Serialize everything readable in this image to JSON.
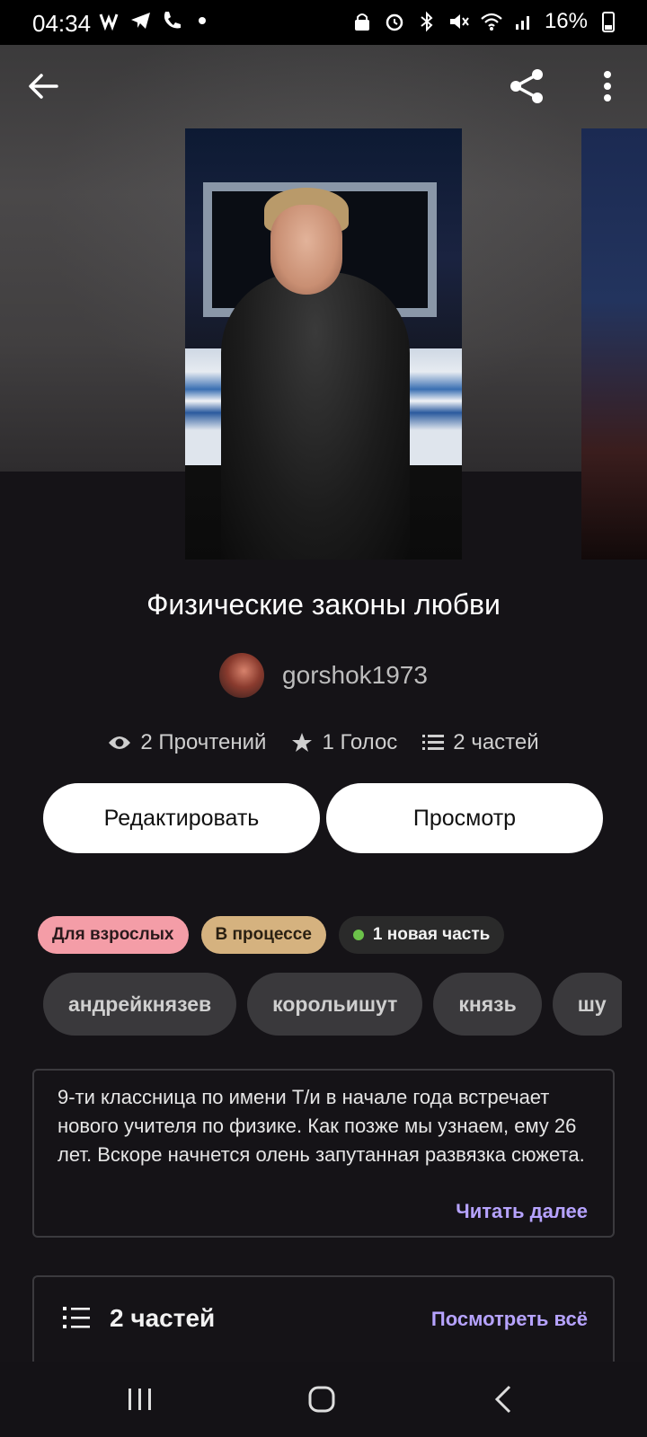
{
  "status_bar": {
    "time": "04:34",
    "battery": "16%"
  },
  "story": {
    "title": "Физические законы любви",
    "author": "gorshok1973",
    "reads": "2 Прочтений",
    "votes": "1 Голос",
    "parts_count": "2 частей"
  },
  "actions": {
    "edit_label": "Редактировать",
    "preview_label": "Просмотр"
  },
  "badges": {
    "adult": "Для взрослых",
    "in_progress": "В процессе",
    "new_part": "1 новая часть"
  },
  "tags": [
    "андрейкнязев",
    "корольишут",
    "князь",
    "шу"
  ],
  "description": {
    "text": "9-ти классница по имени Т/и в начале года встречает нового учителя по физике. Как позже мы узнаем, ему 26 лет. Вскоре начнется олень запутанная развязка сюжета.",
    "read_more": "Читать далее"
  },
  "parts": {
    "title": "2 частей",
    "see_all": "Посмотреть всё"
  },
  "colors": {
    "background": "#151317",
    "accent_link": "#b6a3ff",
    "badge_adult": "#f49da7",
    "badge_progress": "#d5b27f",
    "new_dot": "#6cc24a"
  }
}
